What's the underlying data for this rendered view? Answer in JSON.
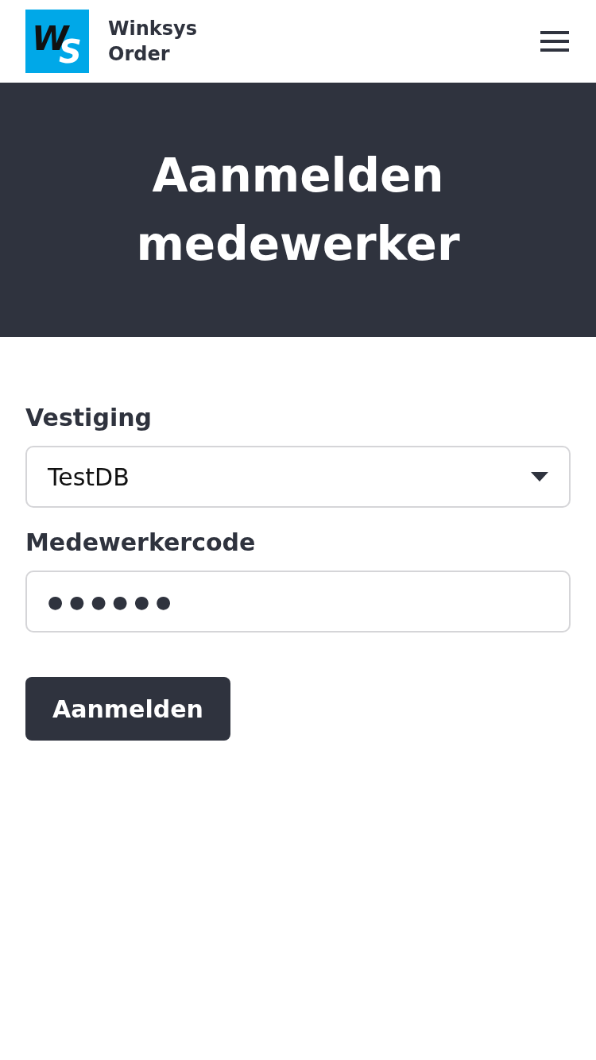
{
  "header": {
    "logo": {
      "letter_1": "W",
      "letter_2": "S"
    },
    "app_name": "Winksys Order"
  },
  "hero": {
    "title": "Aanmelden medewerker"
  },
  "form": {
    "fields": [
      {
        "kind": "select",
        "label": "Vestiging",
        "value": "TestDB"
      },
      {
        "kind": "password",
        "label": "Medewerkercode",
        "value": "●●●●●●"
      }
    ],
    "submit": "Aanmelden"
  }
}
